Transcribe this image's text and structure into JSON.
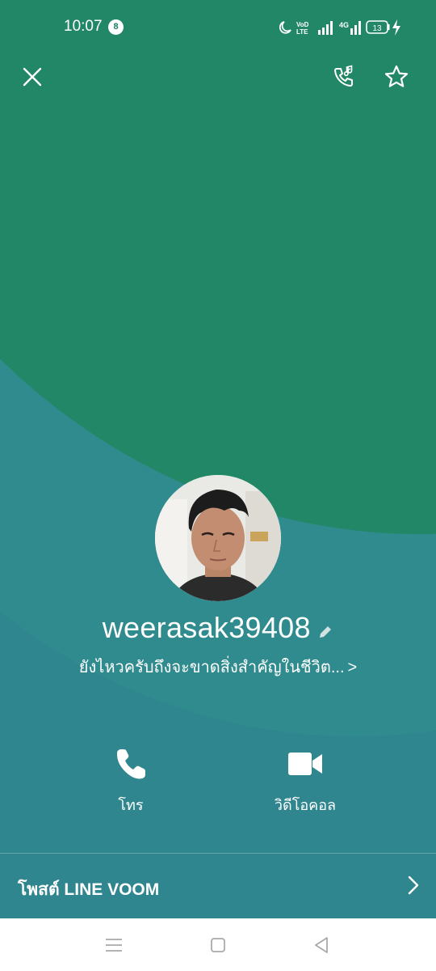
{
  "status_bar": {
    "time": "10:07",
    "notification_count": "8",
    "battery_level": "13",
    "network": "4G"
  },
  "header": {
    "close_icon": "close-icon",
    "ringtone_icon": "call-music-icon",
    "favorite_icon": "star-icon"
  },
  "profile": {
    "name": "weerasak39408",
    "status_message": "ยังไหวครับถึงจะขาดสิ่งสำคัญในชีวิต...",
    "status_chevron": ">"
  },
  "actions": [
    {
      "label": "โทร",
      "icon": "phone-icon"
    },
    {
      "label": "วิดีโอคอล",
      "icon": "video-camera-icon"
    }
  ],
  "voom": {
    "label": "โพสต์ LINE VOOM"
  },
  "colors": {
    "green": "#228766",
    "teal": "#30868e",
    "text": "#ffffff"
  }
}
